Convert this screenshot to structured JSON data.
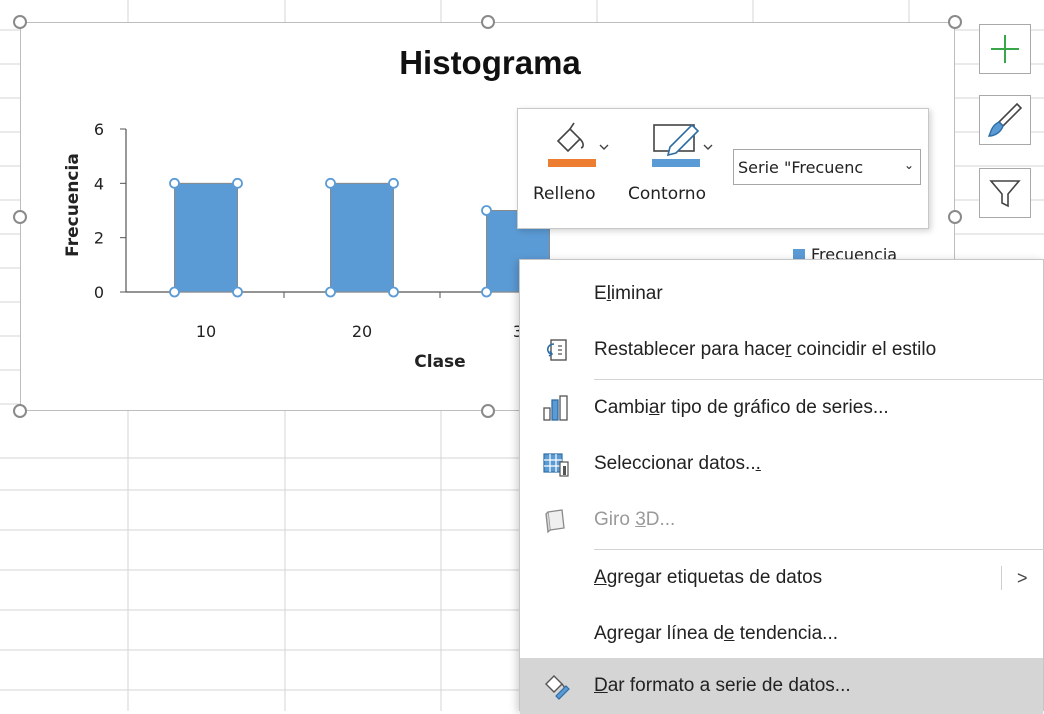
{
  "chart": {
    "title": "Histograma",
    "y_axis_title": "Frecuencia",
    "x_axis_title": "Clase",
    "legend_label": "Frecuencia"
  },
  "chart_data": {
    "type": "bar",
    "title": "Histograma",
    "xlabel": "Clase",
    "ylabel": "Frecuencia",
    "categories": [
      "10",
      "20",
      "3"
    ],
    "series": [
      {
        "name": "Frecuencia",
        "values": [
          4,
          4,
          3
        ]
      }
    ],
    "ylim": [
      0,
      6
    ],
    "yticks": [
      "0",
      "2",
      "4",
      "6"
    ],
    "grid": false,
    "legend": "right",
    "bar_color": "#5b9bd5"
  },
  "mini_toolbar": {
    "fill_label": "Relleno",
    "outline_label": "Contorno",
    "series_select_value": "Serie \"Frecuenc"
  },
  "side_buttons": [
    "add-chart-element-icon",
    "chart-styles-icon",
    "chart-filters-icon"
  ],
  "context_menu": {
    "items": [
      {
        "label": "Eliminar",
        "icon": "",
        "disabled": false
      },
      {
        "label": "Restablecer para hacer coincidir el estilo",
        "icon": "reset-style-icon",
        "disabled": false
      },
      {
        "label": "Cambiar tipo de gráfico de series...",
        "icon": "change-chart-type-icon",
        "disabled": false
      },
      {
        "label": "Seleccionar datos...",
        "icon": "select-data-icon",
        "disabled": false
      },
      {
        "label": "Giro 3D...",
        "icon": "3d-rotation-icon",
        "disabled": true
      },
      {
        "label": "Agregar etiquetas de datos",
        "icon": "",
        "disabled": false,
        "submenu": true,
        "arrow": ">"
      },
      {
        "label": "Agregar línea de tendencia...",
        "icon": "",
        "disabled": false
      },
      {
        "label": "Dar formato a serie de datos...",
        "icon": "format-series-icon",
        "disabled": false,
        "highlighted": true
      }
    ]
  },
  "colors": {
    "accent_fill": "#ed7d31",
    "accent_outline": "#5b9bd5",
    "bar": "#5b9bd5",
    "highlight": "#d5d5d5"
  }
}
